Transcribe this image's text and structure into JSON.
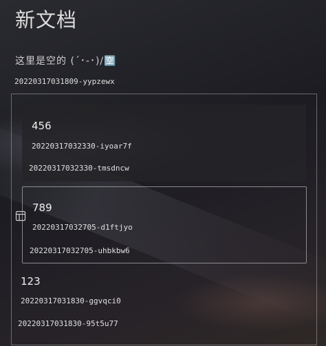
{
  "page": {
    "title": "新文档",
    "empty_text": "这里是空的 (´･-･)/🈳",
    "root_block_id": "20220317031809-yypzewx"
  },
  "blocks": [
    {
      "heading": "456",
      "child_id": "20220317032330-iyoar7f",
      "row_id": "20220317032330-tmsdncw"
    },
    {
      "heading": "789",
      "child_id": "20220317032705-d1ftjyo",
      "row_id": "20220317032705-uhbkbw6"
    },
    {
      "heading": "123",
      "child_id": "20220317031830-ggvqci0",
      "row_id": "20220317031830-95t5u77"
    }
  ]
}
